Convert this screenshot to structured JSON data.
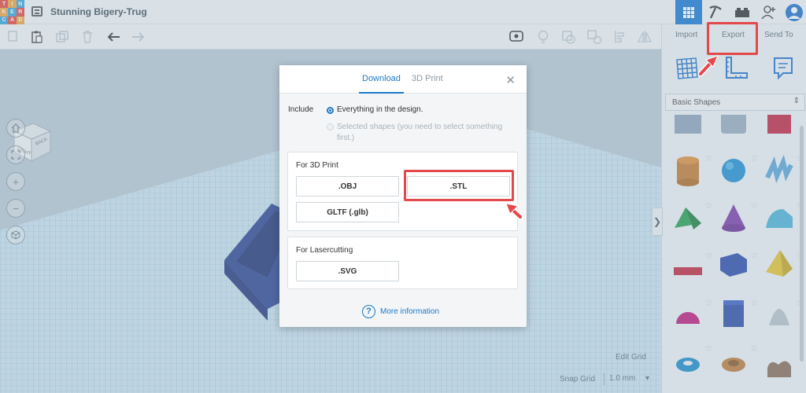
{
  "app": {
    "logo_letters": [
      "T",
      "I",
      "N",
      "K",
      "E",
      "R",
      "C",
      "A",
      "D"
    ],
    "design_title": "Stunning Bigery-Trug"
  },
  "panel": {
    "tabs": [
      "Import",
      "Export",
      "Send To"
    ],
    "shapes_category": "Basic Shapes"
  },
  "modal": {
    "tabs": [
      "Download",
      "3D Print"
    ],
    "include_label": "Include",
    "option_everything": "Everything in the design.",
    "option_selected": "Selected shapes (you need to select something first.)",
    "section_3dprint": "For 3D Print",
    "format_obj": ".OBJ",
    "format_stl": ".STL",
    "format_gltf": "GLTF (.glb)",
    "section_laser": "For Lasercutting",
    "format_svg": ".SVG",
    "more_info": "More information",
    "help_glyph": "?"
  },
  "workplane": {
    "edit_grid": "Edit Grid",
    "snap_grid": "Snap Grid",
    "snap_value": "1.0 mm",
    "cube_faces": [
      "RIGHT",
      "BACK"
    ]
  },
  "colors": {
    "accent": "#1477d1",
    "highlight": "#e3484b",
    "grid_line": "#7fb9d8"
  }
}
